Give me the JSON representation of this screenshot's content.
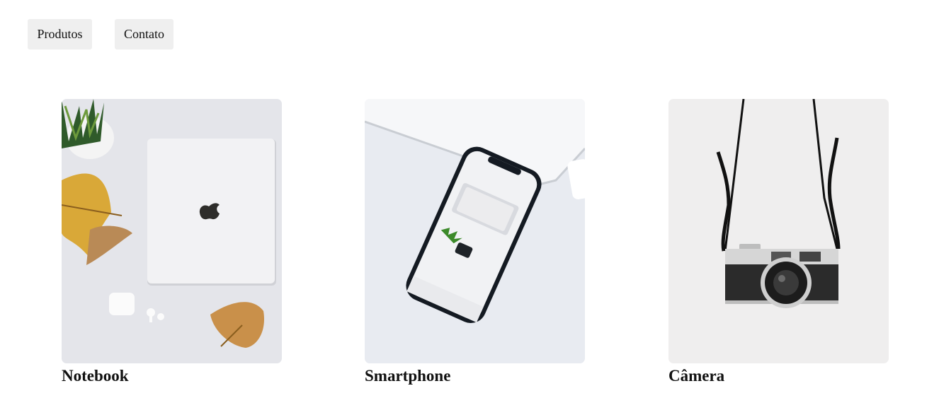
{
  "nav": {
    "produtos_label": "Produtos",
    "contato_label": "Contato"
  },
  "products": [
    {
      "title": "Notebook",
      "image_icon": "laptop-photo"
    },
    {
      "title": "Smartphone",
      "image_icon": "smartphone-photo"
    },
    {
      "title": "Câmera",
      "image_icon": "camera-photo"
    }
  ]
}
